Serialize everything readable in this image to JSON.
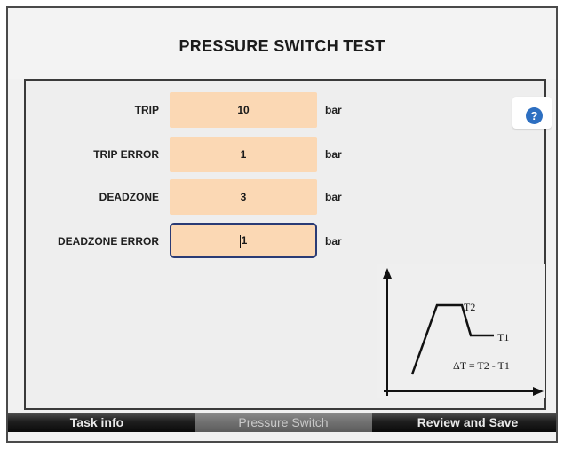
{
  "title": "PRESSURE SWITCH TEST",
  "fields": [
    {
      "label": "TRIP",
      "value": "10",
      "unit": "bar"
    },
    {
      "label": "TRIP ERROR",
      "value": "1",
      "unit": "bar"
    },
    {
      "label": "DEADZONE",
      "value": "3",
      "unit": "bar"
    },
    {
      "label": "DEADZONE ERROR",
      "value": "1",
      "unit": "bar"
    }
  ],
  "help": {
    "icon": "help-icon",
    "glyph": "?"
  },
  "diagram": {
    "t2": "T2",
    "t1": "T1",
    "formula": "ΔT = T2 - T1"
  },
  "tabs": [
    {
      "label": "Task info"
    },
    {
      "label": "Pressure Switch"
    },
    {
      "label": "Review and Save"
    }
  ],
  "colors": {
    "field_bg": "#fbd8b4",
    "active_border": "#2a3b75",
    "help_blue": "#2d6fc1"
  }
}
